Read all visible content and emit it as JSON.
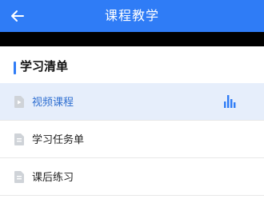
{
  "header": {
    "title": "课程教学",
    "back_icon": "arrow-left-icon"
  },
  "section": {
    "title": "学习清单"
  },
  "items": [
    {
      "label": "视频课程",
      "icon": "video-doc-icon",
      "active": true,
      "indicator": "playing-bars-icon"
    },
    {
      "label": "学习任务单",
      "icon": "doc-icon",
      "active": false
    },
    {
      "label": "课后练习",
      "icon": "doc-icon",
      "active": false
    }
  ],
  "colors": {
    "accent": "#2f7cf6",
    "active_bg": "#e6eefb",
    "icon_gray": "#cfd3d8"
  }
}
